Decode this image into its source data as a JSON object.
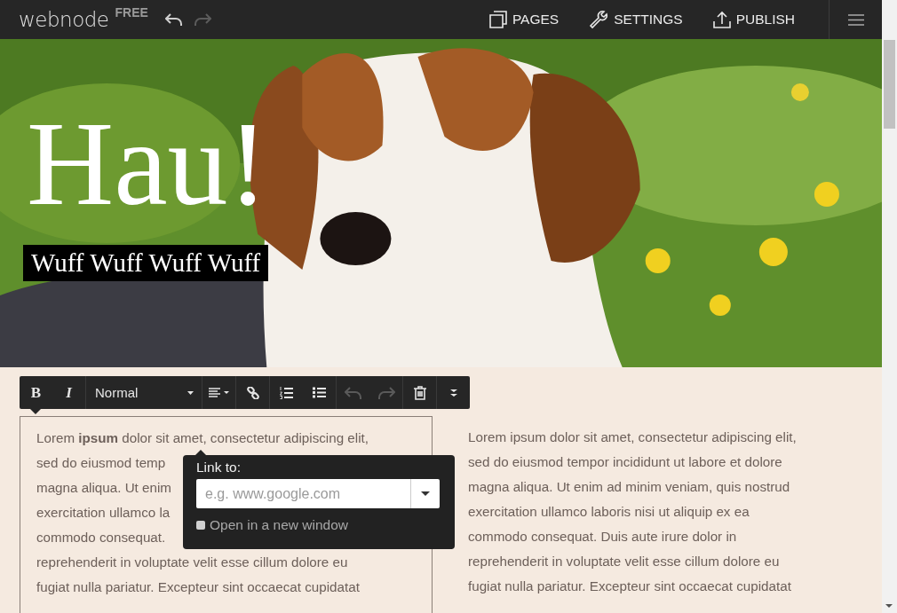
{
  "topbar": {
    "logo": "webnode",
    "plan": "FREE",
    "history": [
      {
        "kind": "undo",
        "disabled": false
      },
      {
        "kind": "redo",
        "disabled": true
      }
    ],
    "nav": [
      {
        "kind": "pages",
        "label": "PAGES"
      },
      {
        "kind": "settings",
        "label": "SETTINGS"
      },
      {
        "kind": "publish",
        "label": "PUBLISH"
      }
    ]
  },
  "hero": {
    "kind": "picture",
    "title": "Hau!",
    "subtitle": "Wuff Wuff Wuff Wuff"
  },
  "toolbar": {
    "groups": [
      [
        {
          "kind": "bold",
          "label": "B",
          "disabled": false
        },
        {
          "kind": "italic",
          "label": "I",
          "disabled": false
        }
      ],
      [
        {
          "kind": "select",
          "label": "Normal",
          "disabled": false
        }
      ],
      [
        {
          "kind": "align",
          "disabled": false
        }
      ],
      [
        {
          "kind": "link",
          "disabled": false
        }
      ],
      [
        {
          "kind": "ordered-list",
          "disabled": false
        },
        {
          "kind": "bullet-list",
          "disabled": false
        }
      ],
      [
        {
          "kind": "undo",
          "disabled": true
        },
        {
          "kind": "redo",
          "disabled": true
        }
      ],
      [
        {
          "kind": "delete",
          "disabled": false
        }
      ],
      [
        {
          "kind": "more",
          "disabled": false
        }
      ]
    ]
  },
  "left_text": {
    "selected": true,
    "lines": [
      "Lorem **ipsum** dolor sit amet, consectetur adipiscing elit,",
      "sed do eiusmod temp",
      "magna aliqua. Ut enim",
      "exercitation ullamco la",
      "commodo consequat.",
      "reprehenderit in voluptate velit esse cillum dolore eu",
      "fugiat nulla pariatur. Excepteur sint occaecat cupidatat"
    ]
  },
  "right_text": {
    "lines": [
      "Lorem ipsum dolor sit amet, consectetur adipiscing elit,",
      "sed do eiusmod tempor incididunt ut labore et dolore",
      "magna aliqua. Ut enim ad minim veniam, quis nostrud",
      "exercitation ullamco laboris nisi ut aliquip ex ea",
      "commodo consequat. Duis aute irure dolor in",
      "reprehenderit in voluptate velit esse cillum dolore eu",
      "fugiat nulla pariatur. Excepteur sint occaecat cupidatat"
    ]
  },
  "link_popup": {
    "label": "Link to:",
    "placeholder": "e.g. www.google.com",
    "new_window": {
      "label": "Open in a new window",
      "checked": false
    }
  }
}
